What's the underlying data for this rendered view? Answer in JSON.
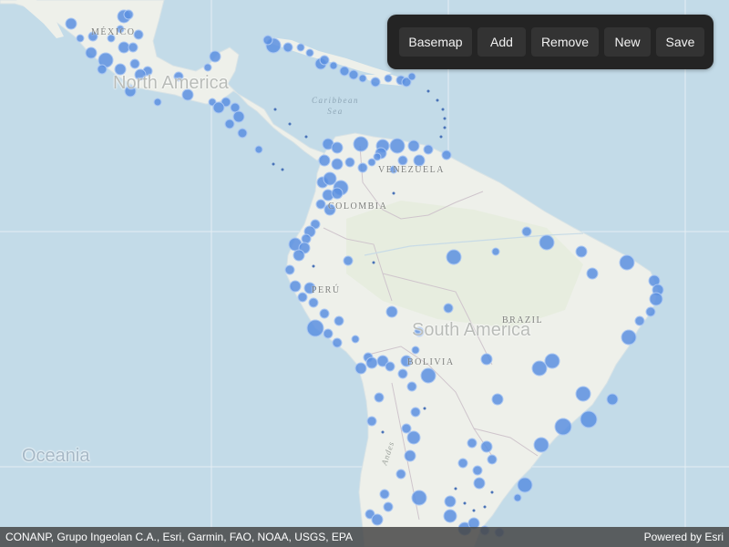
{
  "map": {
    "colors": {
      "water": "#c3dbe8",
      "land": "#eef0ea",
      "land_green": "#e4ebdc",
      "marker_fill": "#5b8fe0",
      "marker_stroke": "#a9c6f2",
      "border": "#c9c2c8"
    },
    "labels": {
      "north_america": "North America",
      "south_america": "South America",
      "oceania": "Oceania",
      "mexico": "MÉXICO",
      "venezuela": "VENEZUELA",
      "colombia": "COLOMBIA",
      "peru": "PERÚ",
      "brazil": "BRAZIL",
      "bolivia": "BOLIVIA",
      "caribbean_sea_line1": "Caribbean",
      "caribbean_sea_line2": "Sea",
      "andes": "Andes"
    },
    "layer": "points-of-interest",
    "marker_icon": "circle-marker"
  },
  "toolbar": {
    "buttons": [
      {
        "id": "basemap",
        "label": "Basemap"
      },
      {
        "id": "add",
        "label": "Add"
      },
      {
        "id": "remove",
        "label": "Remove"
      },
      {
        "id": "new",
        "label": "New"
      },
      {
        "id": "save",
        "label": "Save"
      }
    ]
  },
  "attribution": {
    "sources": "CONANP, Grupo Ingeolan C.A., Esri, Garmin, FAO, NOAA, USGS, EPA",
    "powered_by": "Powered by Esri"
  }
}
